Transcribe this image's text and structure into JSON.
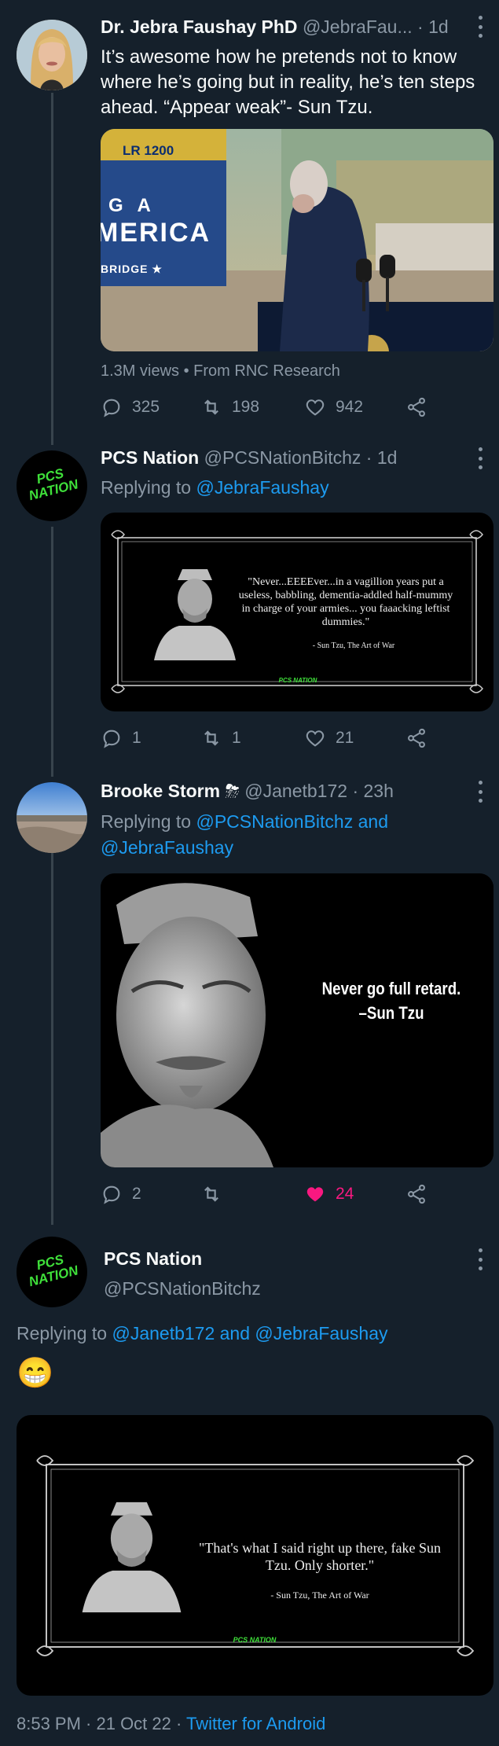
{
  "tweet1": {
    "name": "Dr. Jebra Faushay PhD",
    "handle": "@JebraFau...",
    "time": "· 1d",
    "text": "It’s awesome how he pretends not to know where he’s going but in reality, he’s ten steps ahead. “Appear weak”- Sun Tzu.",
    "media": {
      "sign_top": "LR 1200",
      "sign_line1": "G A",
      "sign_line2": "MERICA",
      "sign_line3": "BRIDGE ★"
    },
    "views": "1.3M views",
    "source": "From RNC Research",
    "replies": "325",
    "retweets": "198",
    "likes": "942"
  },
  "tweet2": {
    "name": "PCS Nation",
    "handle": "@PCSNationBitchz",
    "time": "· 1d",
    "replying_prefix": "Replying to",
    "replying_to": "@JebraFaushay",
    "avatar_text": "PCS NATION",
    "quote": "\"Never...EEEEver...in a vagillion years put a useless, babbling, dementia-addled half-mummy in charge of your armies... you faaacking leftist dummies.\"",
    "attribution": "- Sun Tzu, The Art of War",
    "logo": "PCS NATION",
    "replies": "1",
    "retweets": "1",
    "likes": "21"
  },
  "tweet3": {
    "name": "Brooke Storm",
    "emoji": "⛈",
    "handle": "@Janetb172",
    "time": "· 23h",
    "replying_prefix": "Replying to",
    "replying_to_1": "@PCSNationBitchz",
    "replying_and": "and",
    "replying_to_2": "@JebraFaushay",
    "meme_line1": "Never go full retard.",
    "meme_line2": "–Sun Tzu",
    "replies": "2",
    "retweets": "",
    "likes": "24"
  },
  "tweet4": {
    "name": "PCS Nation",
    "handle": "@PCSNationBitchz",
    "avatar_text": "PCS NATION",
    "replying_prefix": "Replying to",
    "replying_to_1": "@Janetb172",
    "replying_and": "and",
    "replying_to_2": "@JebraFaushay",
    "emoji": "😁",
    "quote": "\"That's what I said right up there, fake Sun Tzu. Only shorter.\"",
    "attribution": "- Sun Tzu, The Art of War",
    "logo": "PCS NATION",
    "timestamp": "8:53 PM · 21 Oct 22 ·",
    "client": "Twitter for Android"
  },
  "colors": {
    "background": "#15202b",
    "accent": "#1d9bf0",
    "like_active": "#f91880",
    "muted": "#8b98a5",
    "pcs_green": "#3fe03a"
  }
}
